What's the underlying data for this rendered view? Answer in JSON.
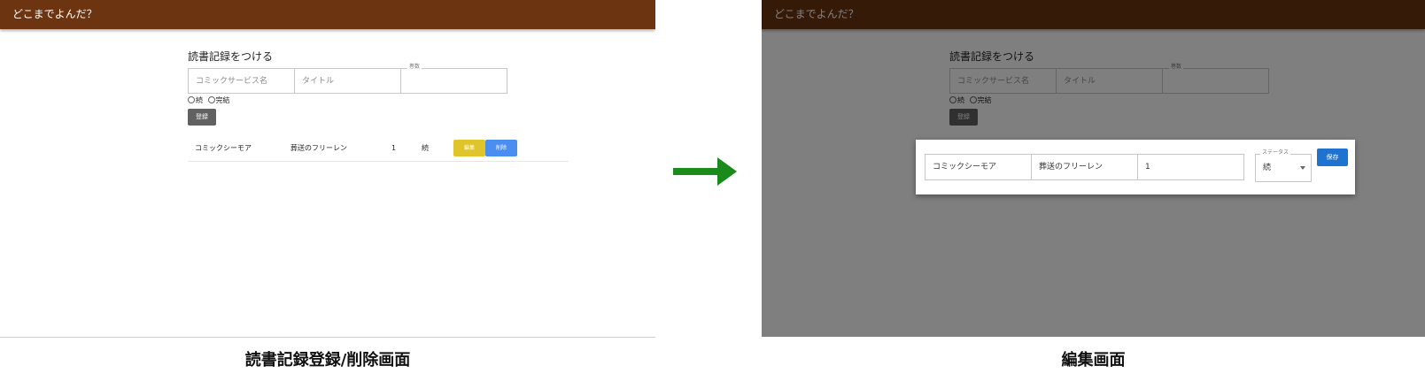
{
  "app": {
    "title": "どこまでよんだ？"
  },
  "form": {
    "section_title": "読書記録をつける",
    "service_placeholder": "コミックサービス名",
    "title_placeholder": "タイトル",
    "volume_label": "巻数",
    "radio_continue": "続",
    "radio_complete": "完結",
    "register_button": "登録"
  },
  "records": [
    {
      "service": "コミックシーモア",
      "title": "葬送のフリーレン",
      "volume": "1",
      "status": "続",
      "edit_label": "編集",
      "delete_label": "削除"
    }
  ],
  "edit_dialog": {
    "service": "コミックシーモア",
    "title": "葬送のフリーレン",
    "volume": "1",
    "status_label": "ステータス",
    "status_value": "続",
    "save_button": "保存"
  },
  "captions": {
    "left": "読書記録登録/削除画面",
    "right": "編集画面"
  },
  "colors": {
    "appbar": "#6c3410",
    "edit": "#e0c52a",
    "delete": "#4a8ef0",
    "save": "#1e73d0",
    "arrow": "#1a8a1a"
  }
}
